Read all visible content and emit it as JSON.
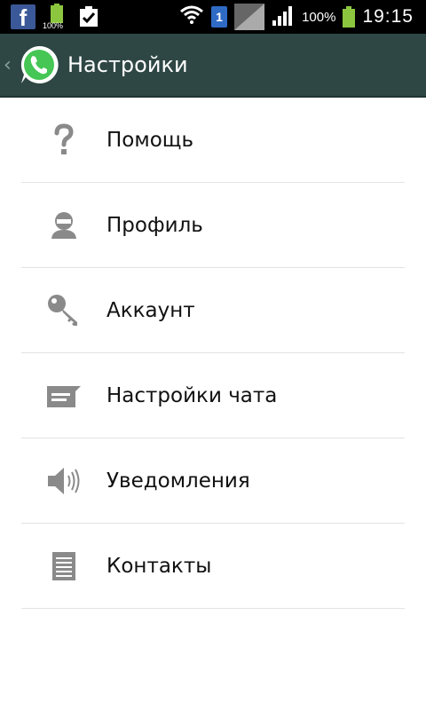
{
  "status_bar": {
    "notification_battery_text": "100%",
    "sim_slot": "1",
    "battery_percent": "100%",
    "time": "19:15",
    "icons": [
      "facebook-icon",
      "battery-notification-icon",
      "clipboard-check-icon",
      "wifi-icon",
      "sim-icon",
      "no-data-icon",
      "signal-icon",
      "battery-icon"
    ]
  },
  "action_bar": {
    "title": "Настройки",
    "icons": [
      "back-chevron-icon",
      "whatsapp-logo"
    ]
  },
  "menu": {
    "items": [
      {
        "label": "Помощь",
        "icon": "help-icon"
      },
      {
        "label": "Профиль",
        "icon": "profile-icon"
      },
      {
        "label": "Аккаунт",
        "icon": "key-icon"
      },
      {
        "label": "Настройки чата",
        "icon": "chat-icon"
      },
      {
        "label": "Уведомления",
        "icon": "speaker-icon"
      },
      {
        "label": "Контакты",
        "icon": "contacts-icon"
      }
    ]
  },
  "colors": {
    "status_bar_bg": "#000000",
    "action_bar_bg": "#2e4744",
    "icon_gray": "#8a8a8a",
    "battery_green": "#8cc63f",
    "divider": "#e3e3e3"
  }
}
